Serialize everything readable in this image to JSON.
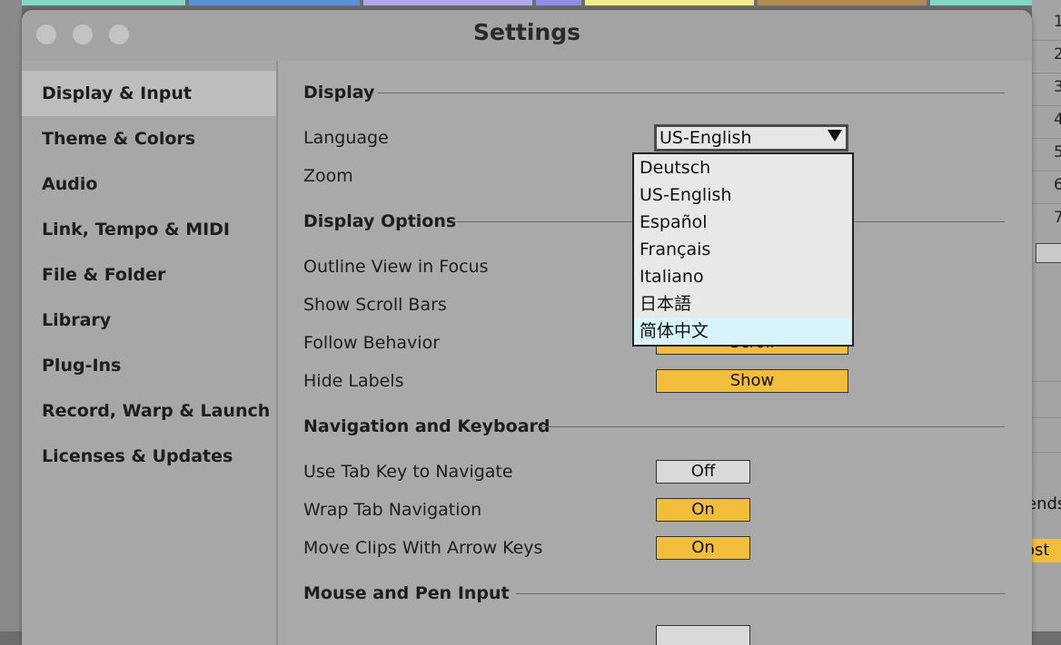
{
  "window": {
    "title": "Settings"
  },
  "sidebar": {
    "items": [
      {
        "label": "Display & Input",
        "active": true
      },
      {
        "label": "Theme & Colors"
      },
      {
        "label": "Audio"
      },
      {
        "label": "Link, Tempo & MIDI"
      },
      {
        "label": "File & Folder"
      },
      {
        "label": "Library"
      },
      {
        "label": "Plug-Ins"
      },
      {
        "label": "Record, Warp & Launch"
      },
      {
        "label": "Licenses & Updates"
      }
    ]
  },
  "display": {
    "heading": "Display",
    "language_label": "Language",
    "language_value": "US-English",
    "zoom_label": "Zoom"
  },
  "display_options": {
    "heading": "Display Options",
    "outline_label": "Outline View in Focus",
    "scrollbars_label": "Show Scroll Bars",
    "follow_label": "Follow Behavior",
    "follow_value": "Scroll",
    "hide_labels_label": "Hide Labels",
    "hide_labels_value": "Show"
  },
  "navigation": {
    "heading": "Navigation and Keyboard",
    "tab_nav_label": "Use Tab Key to Navigate",
    "tab_nav_value": "Off",
    "wrap_label": "Wrap Tab Navigation",
    "wrap_value": "On",
    "move_clips_label": "Move Clips With Arrow Keys",
    "move_clips_value": "On"
  },
  "mouse": {
    "heading": "Mouse and Pen Input"
  },
  "language_dropdown": {
    "options": [
      "Deutsch",
      "US-English",
      "Español",
      "Français",
      "Italiano",
      "日本語",
      "简体中文"
    ],
    "highlighted": "简体中文"
  },
  "background": {
    "track_numbers": [
      "1",
      "2",
      "3",
      "4",
      "5",
      "6",
      "7"
    ],
    "fragment_1": "ends",
    "fragment_2": "ost"
  },
  "colors": {
    "toggle_on": "#f2bd3a",
    "toggle_off": "#d9d9d9",
    "dropdown_highlight": "#d9f3fb"
  }
}
